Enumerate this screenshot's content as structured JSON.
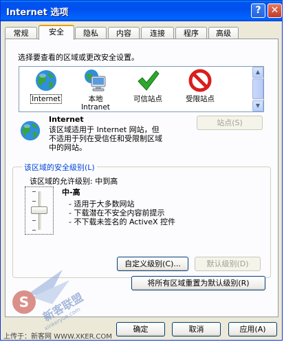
{
  "window": {
    "title": "Internet 选项",
    "help_label": "?",
    "close_label": "✕"
  },
  "tabs": [
    {
      "label": "常规"
    },
    {
      "label": "安全"
    },
    {
      "label": "隐私"
    },
    {
      "label": "内容"
    },
    {
      "label": "连接"
    },
    {
      "label": "程序"
    },
    {
      "label": "高级"
    }
  ],
  "active_tab": "安全",
  "security": {
    "instruction": "选择要查看的区域或更改安全设置。",
    "zones": [
      {
        "label": "Internet",
        "icon": "globe-icon",
        "selected": true
      },
      {
        "label": "本地\nIntranet",
        "icon": "intranet-computer-icon"
      },
      {
        "label": "可信站点",
        "icon": "check-icon"
      },
      {
        "label": "受限站点",
        "icon": "no-entry-icon"
      }
    ],
    "zone_info": {
      "title": "Internet",
      "description_lines": [
        "该区域适用于 Internet 网站，但",
        "不适用于列在受信任和受限制区域",
        "中的网站。"
      ],
      "icon": "globe-icon"
    },
    "sites_button": "站点(S)",
    "level_group_title": "该区域的安全级别(L)",
    "allowed_levels": "该区域的允许级别: 中到高",
    "level_name": "中-高",
    "level_bullets": [
      "- 适用于大多数网站",
      "- 下载潜在不安全内容前提示",
      "- 不下载未签名的 ActiveX 控件"
    ],
    "custom_level_button": "自定义级别(C)...",
    "default_level_button": "默认级别(D)",
    "reset_all_button": "将所有区域重置为默认级别(R)"
  },
  "footer": {
    "ok": "确定",
    "cancel": "取消",
    "apply": "应用(A)"
  },
  "watermark": {
    "text": "上传于：新客网 WWW.XKER.COM",
    "logo_text": "新客联盟",
    "logo_sub": "xinkeryue.com"
  },
  "colors": {
    "title_bar": "#0053ee",
    "dialog_bg": "#ece9d8",
    "link_blue": "#0046d5"
  }
}
